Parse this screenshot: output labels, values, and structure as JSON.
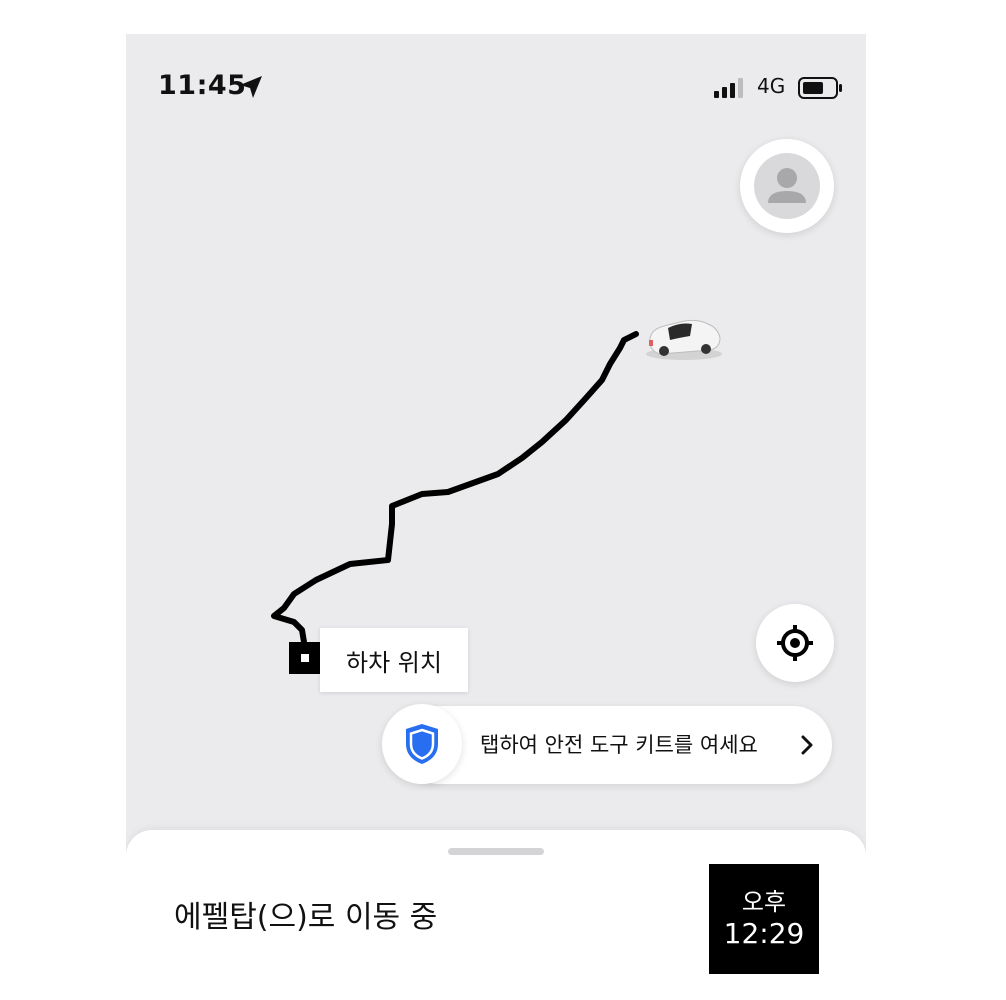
{
  "status_bar": {
    "time": "11:45",
    "network": "4G"
  },
  "map": {
    "dropoff_label": "하차 위치",
    "route_color": "#000000"
  },
  "safety": {
    "text": "탭하여 안전 도구 키트를 여세요",
    "shield_color": "#276ef1"
  },
  "trip": {
    "status": "에펠탑(으)로 이동 중",
    "eta_period": "오후",
    "eta_time": "12:29"
  },
  "icons": [
    "location-arrow-icon",
    "signal-icon",
    "battery-icon",
    "profile-icon",
    "car-icon",
    "recenter-icon",
    "shield-icon",
    "chevron-right-icon"
  ]
}
